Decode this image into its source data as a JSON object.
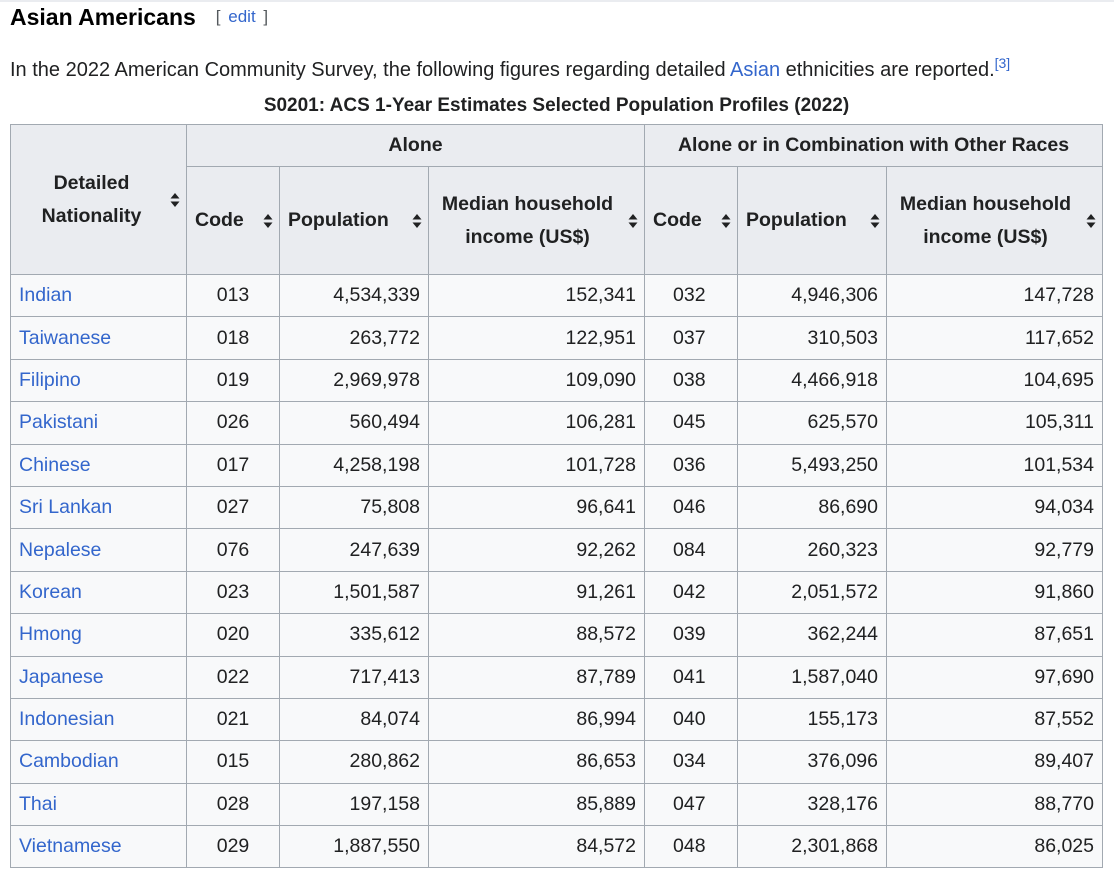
{
  "section": {
    "title": "Asian Americans",
    "edit_open": "[",
    "edit_label": "edit",
    "edit_close": "]"
  },
  "intro": {
    "text_before": "In the 2022 American Community Survey, the following figures regarding detailed ",
    "link": "Asian",
    "text_after": " ethnicities are reported.",
    "citation": "[3]"
  },
  "table": {
    "caption": "S0201: ACS 1-Year Estimates Selected Population Profiles (2022)",
    "groups": {
      "alone": "Alone",
      "combination": "Alone or in Combination with Other Races"
    },
    "headers": {
      "nationality": "Detailed Nationality",
      "code": "Code",
      "population": "Population",
      "income": "Median household income (US$)"
    },
    "sort_icon": "sort-arrows-icon",
    "rows": [
      {
        "name": "Indian",
        "code1": "013",
        "pop1": "4,534,339",
        "inc1": "152,341",
        "code2": "032",
        "pop2": "4,946,306",
        "inc2": "147,728"
      },
      {
        "name": "Taiwanese",
        "code1": "018",
        "pop1": "263,772",
        "inc1": "122,951",
        "code2": "037",
        "pop2": "310,503",
        "inc2": "117,652"
      },
      {
        "name": "Filipino",
        "code1": "019",
        "pop1": "2,969,978",
        "inc1": "109,090",
        "code2": "038",
        "pop2": "4,466,918",
        "inc2": "104,695"
      },
      {
        "name": "Pakistani",
        "code1": "026",
        "pop1": "560,494",
        "inc1": "106,281",
        "code2": "045",
        "pop2": "625,570",
        "inc2": "105,311"
      },
      {
        "name": "Chinese",
        "code1": "017",
        "pop1": "4,258,198",
        "inc1": "101,728",
        "code2": "036",
        "pop2": "5,493,250",
        "inc2": "101,534"
      },
      {
        "name": "Sri Lankan",
        "code1": "027",
        "pop1": "75,808",
        "inc1": "96,641",
        "code2": "046",
        "pop2": "86,690",
        "inc2": "94,034"
      },
      {
        "name": "Nepalese",
        "code1": "076",
        "pop1": "247,639",
        "inc1": "92,262",
        "code2": "084",
        "pop2": "260,323",
        "inc2": "92,779"
      },
      {
        "name": "Korean",
        "code1": "023",
        "pop1": "1,501,587",
        "inc1": "91,261",
        "code2": "042",
        "pop2": "2,051,572",
        "inc2": "91,860"
      },
      {
        "name": "Hmong",
        "code1": "020",
        "pop1": "335,612",
        "inc1": "88,572",
        "code2": "039",
        "pop2": "362,244",
        "inc2": "87,651"
      },
      {
        "name": "Japanese",
        "code1": "022",
        "pop1": "717,413",
        "inc1": "87,789",
        "code2": "041",
        "pop2": "1,587,040",
        "inc2": "97,690"
      },
      {
        "name": "Indonesian",
        "code1": "021",
        "pop1": "84,074",
        "inc1": "86,994",
        "code2": "040",
        "pop2": "155,173",
        "inc2": "87,552"
      },
      {
        "name": "Cambodian",
        "code1": "015",
        "pop1": "280,862",
        "inc1": "86,653",
        "code2": "034",
        "pop2": "376,096",
        "inc2": "89,407"
      },
      {
        "name": "Thai",
        "code1": "028",
        "pop1": "197,158",
        "inc1": "85,889",
        "code2": "047",
        "pop2": "328,176",
        "inc2": "88,770"
      },
      {
        "name": "Vietnamese",
        "code1": "029",
        "pop1": "1,887,550",
        "inc1": "84,572",
        "code2": "048",
        "pop2": "2,301,868",
        "inc2": "86,025"
      }
    ]
  }
}
